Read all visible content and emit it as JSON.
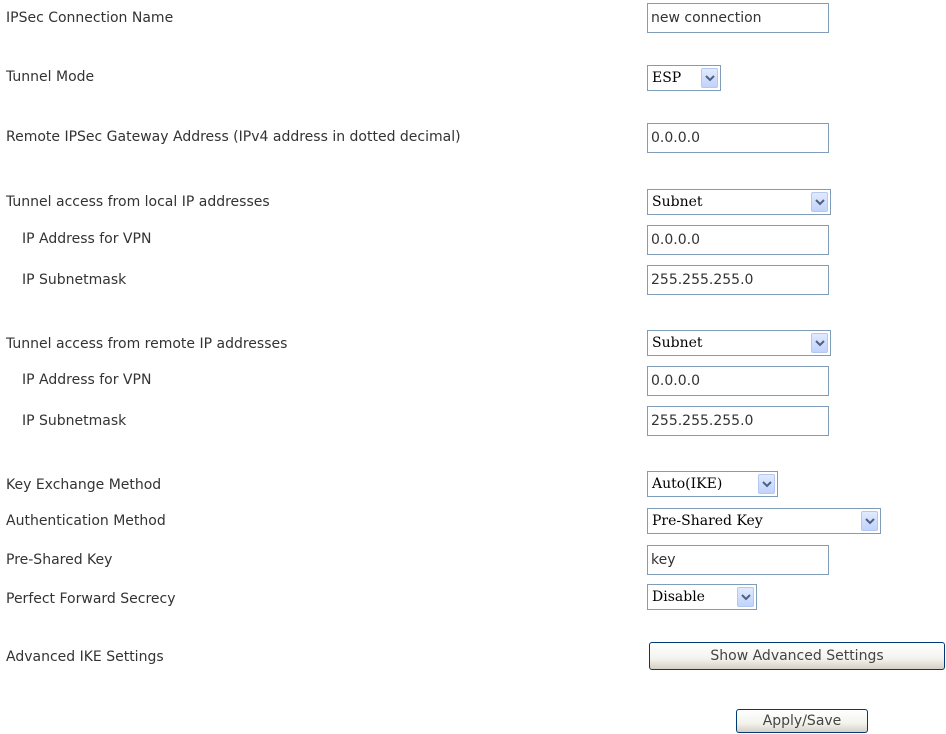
{
  "form": {
    "connection_name": {
      "label": "IPSec Connection Name",
      "value": "new connection"
    },
    "tunnel_mode": {
      "label": "Tunnel Mode",
      "value": "ESP"
    },
    "remote_gateway": {
      "label": "Remote IPSec Gateway Address (IPv4 address in dotted decimal)",
      "value": "0.0.0.0"
    },
    "local_access": {
      "label": "Tunnel access from local IP addresses",
      "value": "Subnet",
      "ip_label": "IP Address for VPN",
      "ip_value": "0.0.0.0",
      "mask_label": "IP Subnetmask",
      "mask_value": "255.255.255.0"
    },
    "remote_access": {
      "label": "Tunnel access from remote IP addresses",
      "value": "Subnet",
      "ip_label": "IP Address for VPN",
      "ip_value": "0.0.0.0",
      "mask_label": "IP Subnetmask",
      "mask_value": "255.255.255.0"
    },
    "key_exchange": {
      "label": "Key Exchange Method",
      "value": "Auto(IKE)"
    },
    "auth_method": {
      "label": "Authentication Method",
      "value": "Pre-Shared Key"
    },
    "pre_shared_key": {
      "label": "Pre-Shared Key",
      "value": "key"
    },
    "pfs": {
      "label": "Perfect Forward Secrecy",
      "value": "Disable"
    },
    "advanced": {
      "label": "Advanced IKE Settings",
      "button": "Show Advanced Settings"
    }
  },
  "actions": {
    "apply_save": "Apply/Save"
  },
  "icons": {
    "dropdown_arrow": "chevron-down-icon"
  },
  "colors": {
    "input_border": "#7f9db9",
    "arrow": "#4d6185",
    "button_border": "#003c74"
  }
}
